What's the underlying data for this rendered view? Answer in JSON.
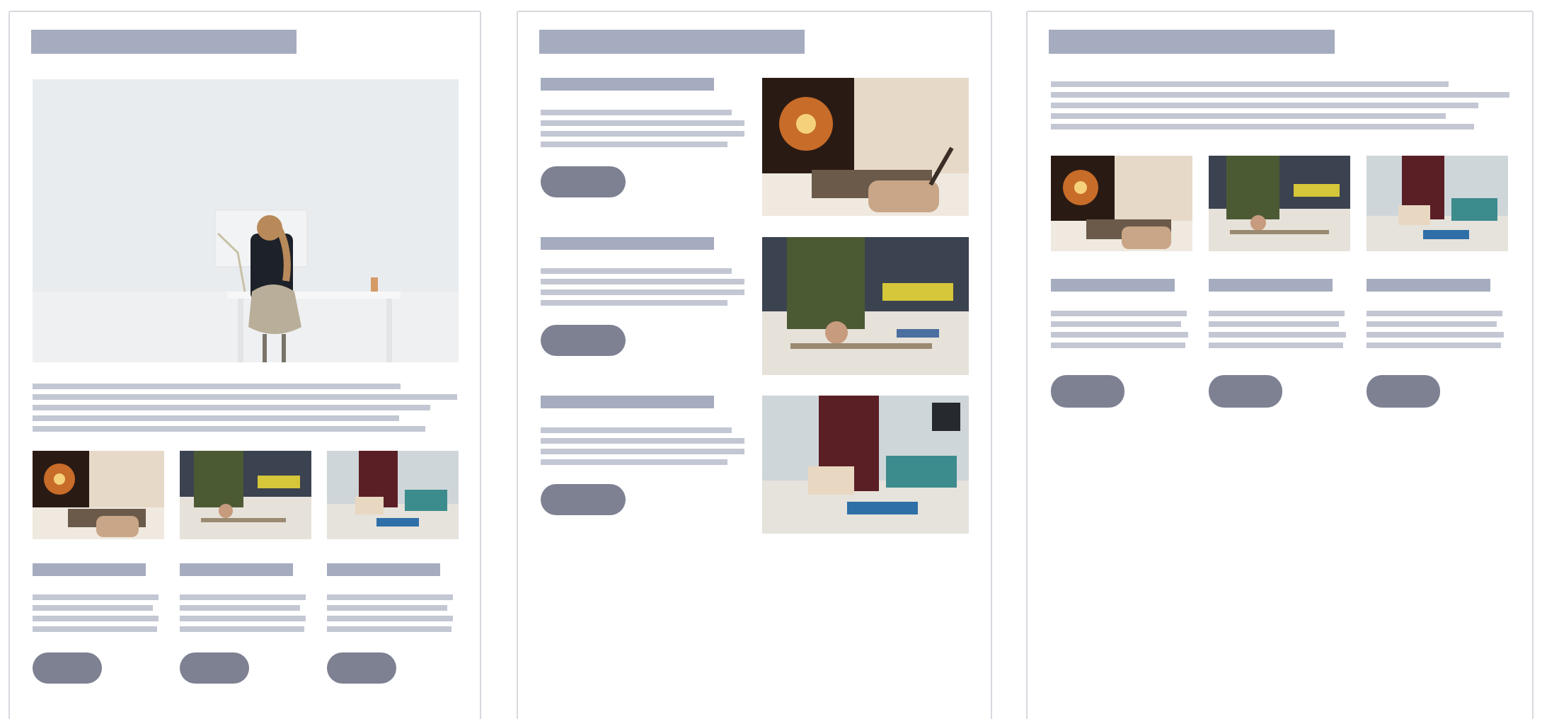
{
  "templates": [
    {
      "name": "hero-image-with-three-columns"
    },
    {
      "name": "alternating-rows-with-images"
    },
    {
      "name": "three-column-cards"
    }
  ],
  "photos": [
    {
      "subject": "woman-at-desk",
      "colors": {
        "wall": "#e9ecef",
        "desk": "#f4f4f4",
        "jacket": "#1d2129",
        "hair": "#b88a5a",
        "chair": "#b9ae99"
      }
    },
    {
      "subject": "laptop-and-stylus",
      "colors": {
        "bg": "#e7d9c8",
        "screen": "#2a1a14",
        "burst": "#e37b2d",
        "table": "#efe9e0"
      }
    },
    {
      "subject": "hands-working-on-craft",
      "colors": {
        "shirt": "#4c5a34",
        "table": "#e6e2da",
        "bg": "#3b4250",
        "accent": "#d6c63a"
      }
    },
    {
      "subject": "woodworking-bench",
      "colors": {
        "shirt": "#5a1f24",
        "bg": "#cfd6da",
        "table": "#e6e2dc",
        "teal": "#3c8b8d"
      }
    }
  ],
  "palette": {
    "bar": "#a6acbf",
    "line": "#c3c7d3",
    "button": "#7d8192",
    "border": "#d7d9df"
  }
}
